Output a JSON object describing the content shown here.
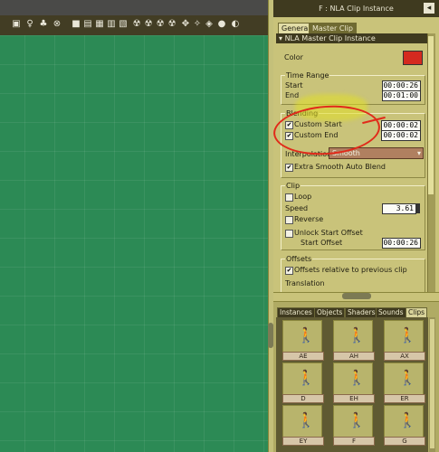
{
  "toolbar": {
    "icons": [
      "camera-icon",
      "person-icon",
      "group-icon",
      "target-icon",
      "display-mode-icons",
      "view-icons",
      "render-icons"
    ]
  },
  "panel": {
    "title": "F : NLA Clip Instance",
    "pin_icon": "pin-icon",
    "tabs": [
      "General",
      "Master Clip"
    ],
    "active_tab": "Master Clip",
    "section_header": "NLA Master Clip Instance",
    "color_label": "Color",
    "color_value": "#d42a1f",
    "time_range": {
      "title": "Time Range",
      "start_label": "Start",
      "start_value": "00:00:26",
      "end_label": "End",
      "end_value": "00:01:00"
    },
    "blending": {
      "title": "Blending",
      "custom_start_label": "Custom Start",
      "custom_start_value": "00:00:02",
      "custom_end_label": "Custom End",
      "custom_end_value": "00:00:02",
      "interpolation_label": "Interpolation",
      "interpolation_value": "Smooth",
      "extra_smooth_label": "Extra Smooth Auto Blend"
    },
    "clip": {
      "title": "Clip",
      "loop_label": "Loop",
      "speed_label": "Speed",
      "speed_value": "3.61",
      "reverse_label": "Reverse",
      "unlock_label": "Unlock Start Offset",
      "start_offset_label": "Start Offset",
      "start_offset_value": "00:00:26"
    },
    "offsets": {
      "title": "Offsets",
      "relative_label": "Offsets relative to previous clip",
      "translation_label": "Translation"
    }
  },
  "library": {
    "tabs": [
      "Instances",
      "Objects",
      "Shaders",
      "Sounds",
      "Clips"
    ],
    "active_tab": "Clips",
    "clips": [
      "AE",
      "AH",
      "AX",
      "D",
      "EH",
      "ER",
      "EY",
      "F",
      "G"
    ]
  }
}
